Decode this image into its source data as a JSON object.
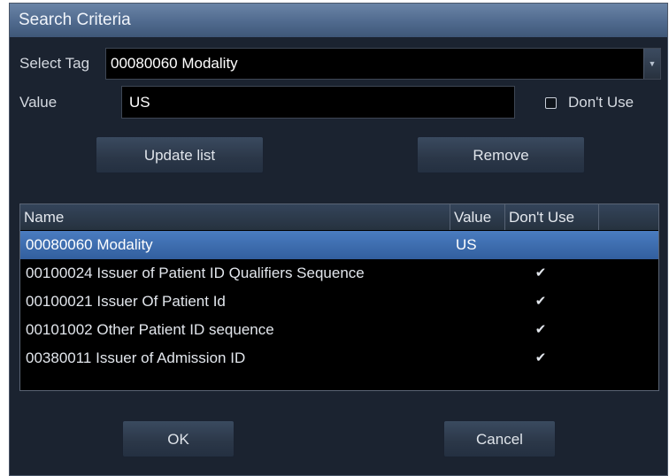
{
  "dialog": {
    "title": "Search Criteria",
    "select_tag_label": "Select Tag",
    "select_tag_value": "00080060 Modality",
    "value_label": "Value",
    "value_input": "US",
    "dont_use_label": "Don't Use",
    "dont_use_checked": false,
    "update_list_label": "Update list",
    "remove_label": "Remove",
    "ok_label": "OK",
    "cancel_label": "Cancel"
  },
  "table": {
    "columns": [
      "Name",
      "Value",
      "Don't Use"
    ],
    "rows": [
      {
        "name": "00080060 Modality",
        "value": "US",
        "dont_use": "",
        "selected": true
      },
      {
        "name": "00100024 Issuer of Patient ID Qualifiers Sequence",
        "value": "",
        "dont_use": "✔"
      },
      {
        "name": "00100021 Issuer Of Patient Id",
        "value": "",
        "dont_use": "✔"
      },
      {
        "name": "00101002 Other Patient ID sequence",
        "value": "",
        "dont_use": "✔"
      },
      {
        "name": "00380011 Issuer of Admission ID",
        "value": "",
        "dont_use": "✔"
      }
    ]
  },
  "colors": {
    "title_bar": "#5a7496",
    "selected_row": "#3f6fb0",
    "dialog_background": "#1b2330"
  },
  "icons": {
    "dropdown": "chevron-down-icon",
    "checkmark": "checkmark-icon"
  }
}
